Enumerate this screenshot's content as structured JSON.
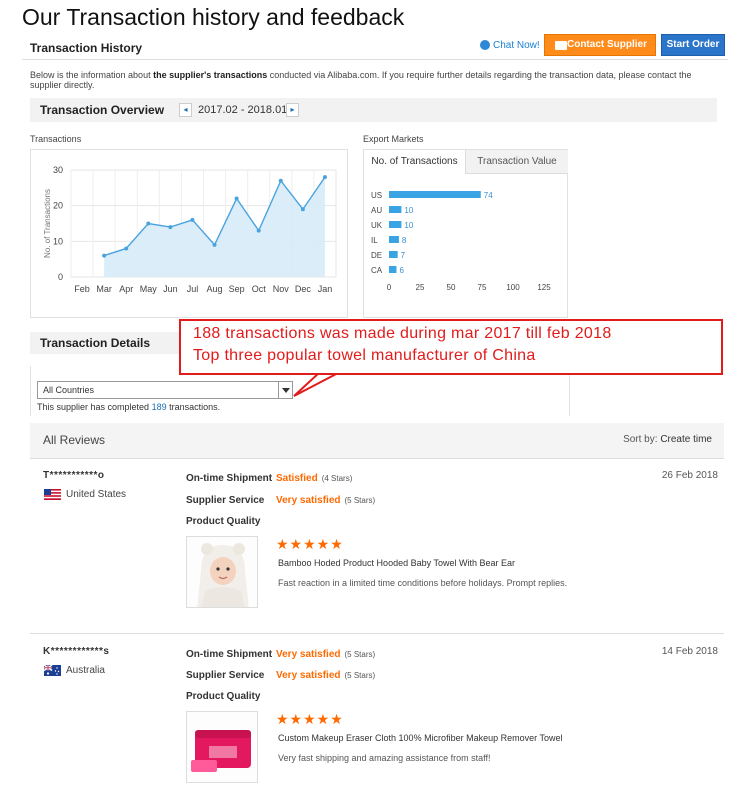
{
  "page_title": "Our Transaction history and feedback",
  "header": {
    "title": "Transaction History",
    "chat_now": "Chat Now!",
    "contact_supplier": "Contact Supplier",
    "start_order": "Start Order"
  },
  "intro": {
    "prefix": "Below is the information about ",
    "bold": "the supplier's transactions",
    "suffix": " conducted via Alibaba.com. If you require further details regarding the transaction data, please contact the supplier directly."
  },
  "overview": {
    "title": "Transaction Overview",
    "prev": "◂",
    "next": "▸",
    "period": "2017.02 - 2018.01",
    "transactions_label": "Transactions",
    "export_markets_label": "Export Markets",
    "tab_count": "No. of Transactions",
    "tab_value": "Transaction Value"
  },
  "chart_data": [
    {
      "type": "area",
      "ylabel": "No. of Transactions",
      "categories": [
        "Feb",
        "Mar",
        "Apr",
        "May",
        "Jun",
        "Jul",
        "Aug",
        "Sep",
        "Oct",
        "Nov",
        "Dec",
        "Jan"
      ],
      "yticks": [
        0,
        10,
        20,
        30
      ],
      "ylim": [
        0,
        30
      ],
      "series": [
        {
          "values": [
            null,
            6,
            8,
            15,
            14,
            16,
            9,
            22,
            13,
            27,
            19,
            28
          ]
        }
      ],
      "fill_color": "#d6ebf8",
      "line_color": "#4aa3df",
      "grid": true
    },
    {
      "type": "bar",
      "orientation": "horizontal",
      "categories": [
        "US",
        "AU",
        "UK",
        "IL",
        "DE",
        "CA"
      ],
      "values": [
        74,
        10,
        10,
        8,
        7,
        6
      ],
      "xticks": [
        0,
        25,
        50,
        75,
        100,
        125
      ],
      "xlim": [
        0,
        125
      ],
      "bar_color": "#3aa3e3",
      "label_color": "#3a8ed0"
    }
  ],
  "details": {
    "title": "Transaction Details",
    "country_select": "All Countries",
    "completed_prefix": "This supplier has completed ",
    "completed_count": "189",
    "completed_suffix": " transactions."
  },
  "callout": {
    "line1": "188 transactions was made during mar 2017 till feb 2018",
    "line2": "Top three popular towel manufacturer of China",
    "color": "#e21b1b"
  },
  "reviews": {
    "title": "All Reviews",
    "sort_label": "Sort by:",
    "sort_value": "Create time",
    "label_shipment": "On-time Shipment",
    "label_service": "Supplier Service",
    "label_quality": "Product Quality",
    "stars_glyph": "★★★★★",
    "items": [
      {
        "user": "T***********o",
        "country": "United States",
        "flag": "us-flag-icon",
        "shipment": "Satisfied",
        "shipment_stars": "(4 Stars)",
        "service": "Very satisfied",
        "service_stars": "(5 Stars)",
        "date": "26 Feb 2018",
        "product": "Bamboo Hoded Product Hooded Baby Towel With Bear Ear",
        "comment": "Fast reaction in a limited time conditions before holidays. Prompt replies."
      },
      {
        "user": "K************s",
        "country": "Australia",
        "flag": "au-flag-icon",
        "shipment": "Very satisfied",
        "shipment_stars": "(5 Stars)",
        "service": "Very satisfied",
        "service_stars": "(5 Stars)",
        "date": "14 Feb 2018",
        "product": "Custom Makeup Eraser Cloth 100% Microfiber Makeup Remover Towel",
        "comment": "Very fast shipping and amazing assistance from staff!"
      }
    ]
  }
}
